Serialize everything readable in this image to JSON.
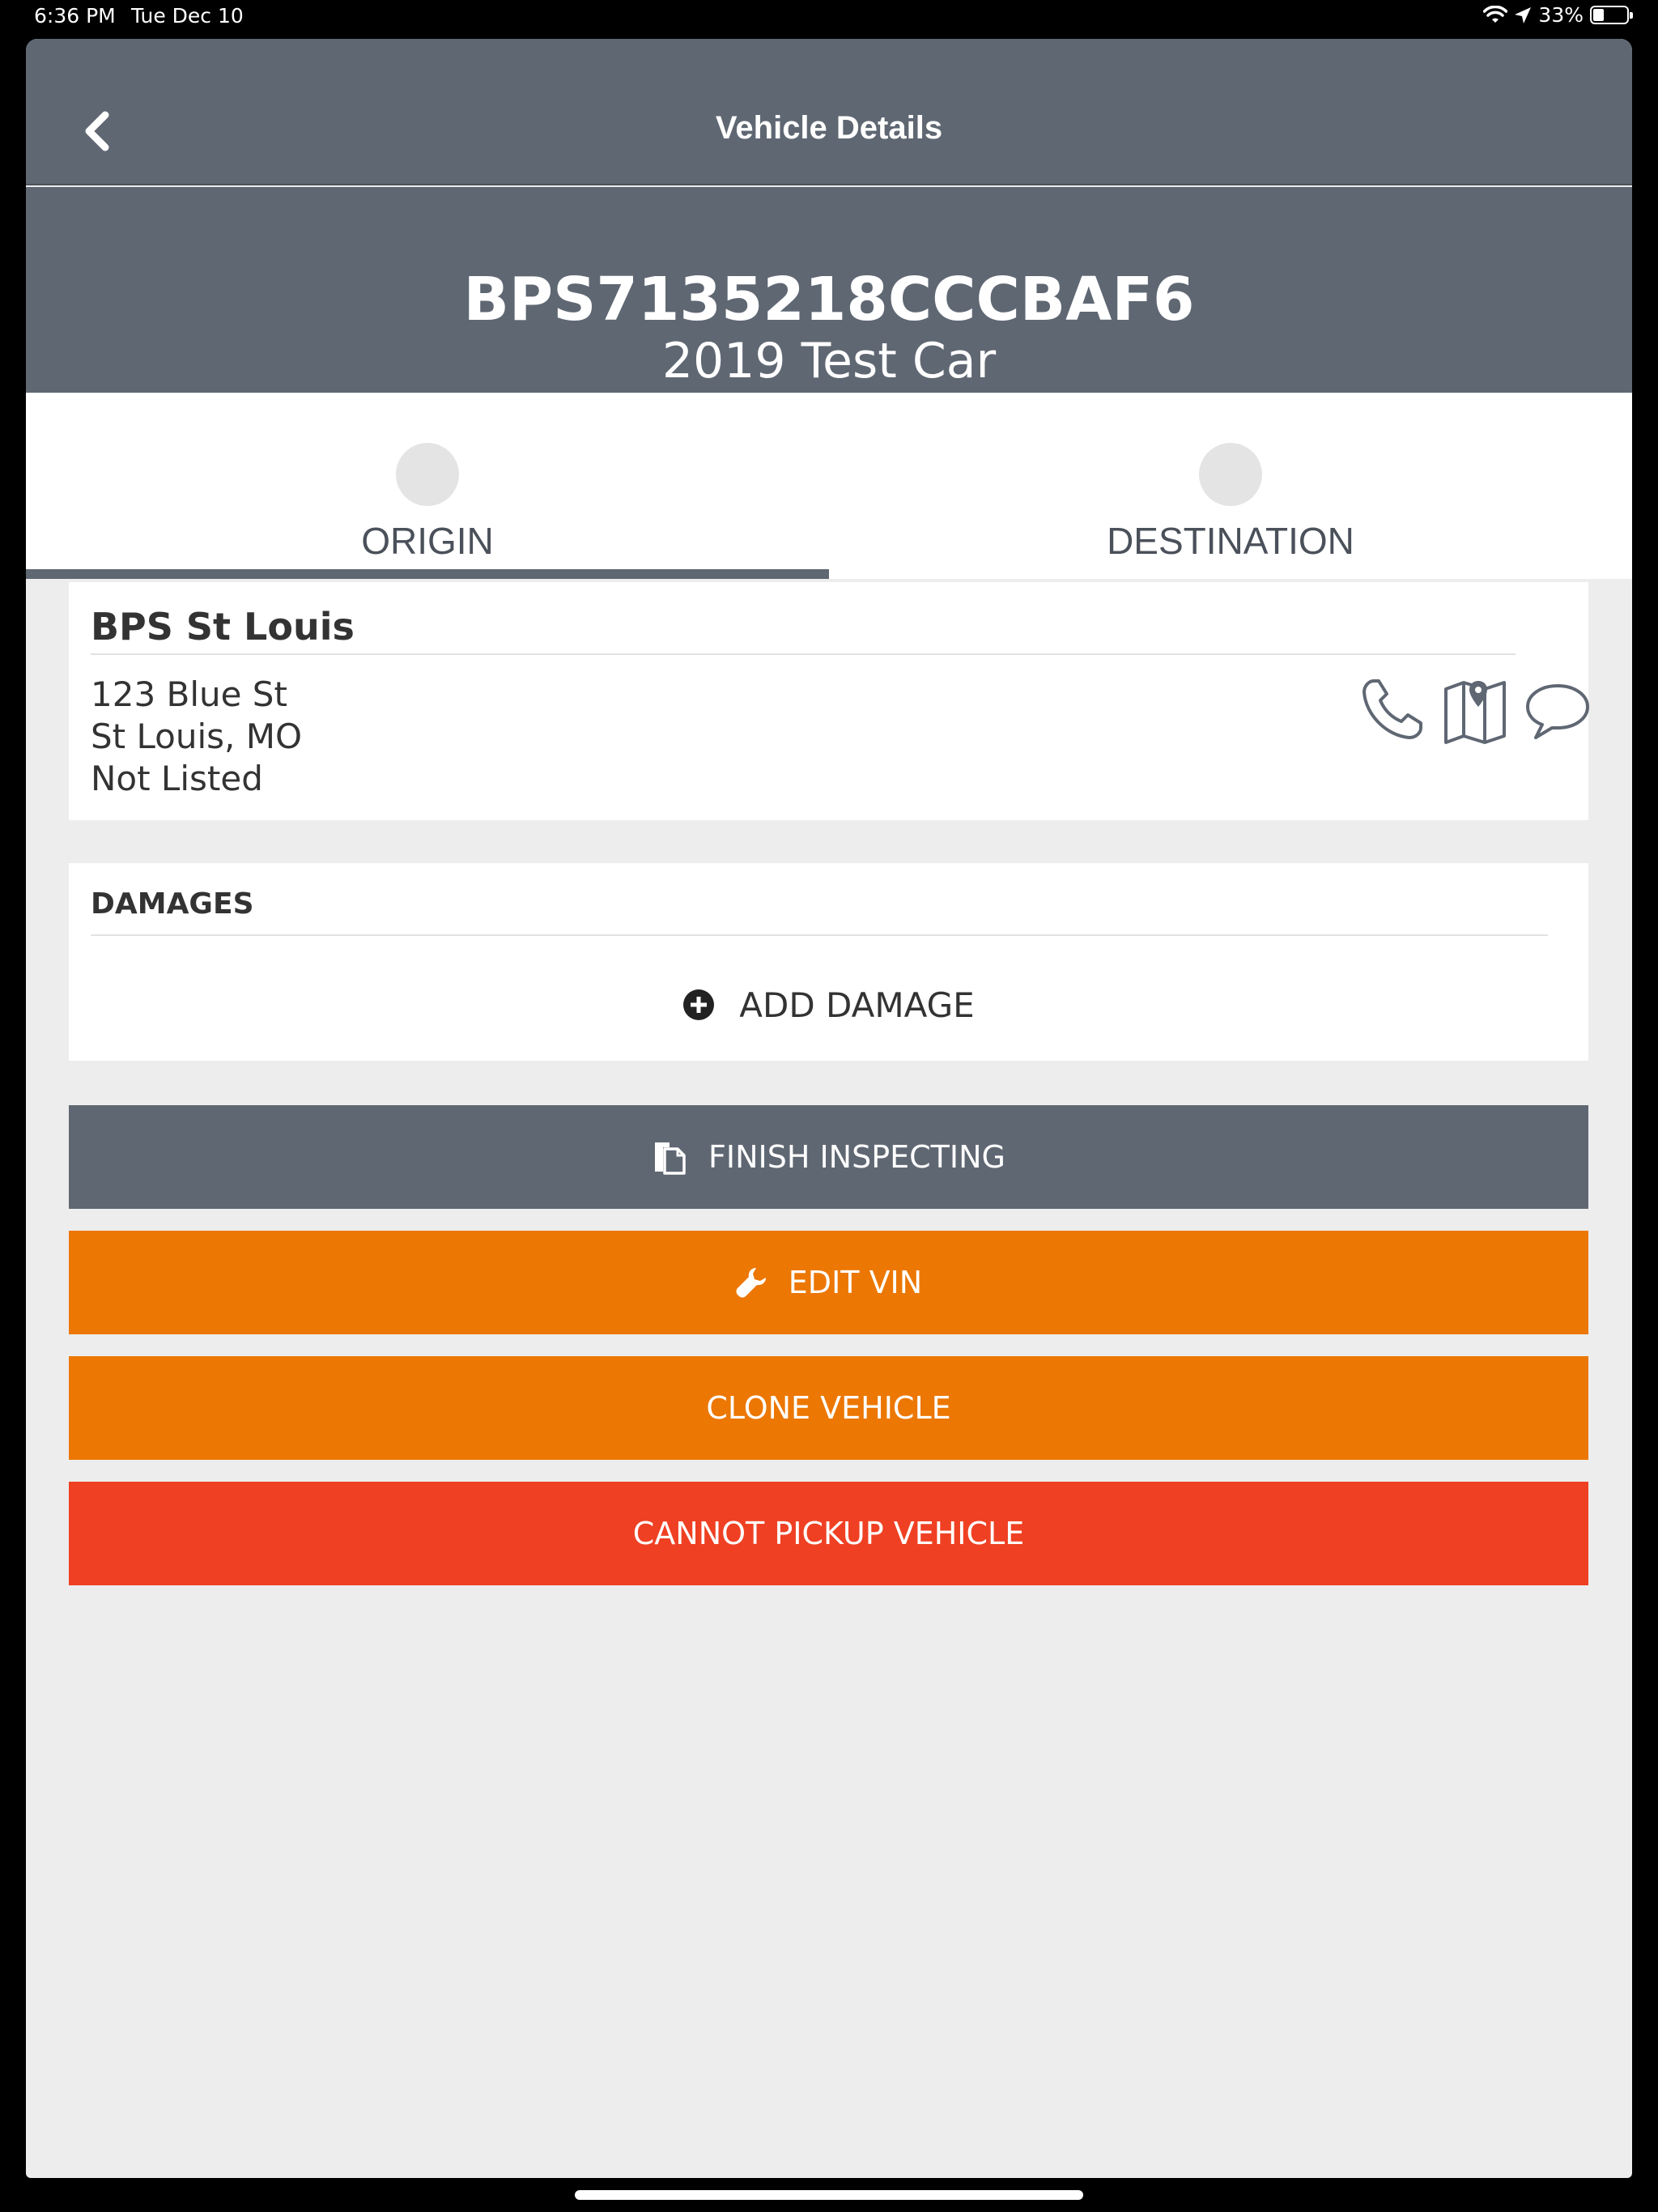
{
  "status_bar": {
    "time": "6:36 PM",
    "date": "Tue Dec 10",
    "battery": "33%",
    "battery_level": 0.33
  },
  "nav": {
    "title": "Vehicle Details",
    "back_icon": "chevron-left-icon"
  },
  "vehicle": {
    "vin": "BPS7135218CCCBAF6",
    "name": "2019 Test Car"
  },
  "tabs": [
    {
      "label": "ORIGIN",
      "active": true
    },
    {
      "label": "DESTINATION",
      "active": false
    }
  ],
  "location": {
    "name": "BPS St Louis",
    "address_line1": "123 Blue St",
    "address_line2": "St Louis, MO",
    "address_line3": "Not Listed",
    "icons": [
      "phone-icon",
      "map-icon",
      "chat-icon"
    ]
  },
  "damages": {
    "title": "DAMAGES",
    "add_label": "ADD DAMAGE"
  },
  "actions": {
    "finish_label": "FINISH INSPECTING",
    "edit_vin_label": "EDIT VIN",
    "clone_label": "CLONE VEHICLE",
    "cannot_pickup_label": "CANNOT PICKUP VEHICLE"
  },
  "colors": {
    "header": "#5f6773",
    "orange": "#ec7702",
    "red": "#ef4023",
    "background": "#ededed"
  }
}
